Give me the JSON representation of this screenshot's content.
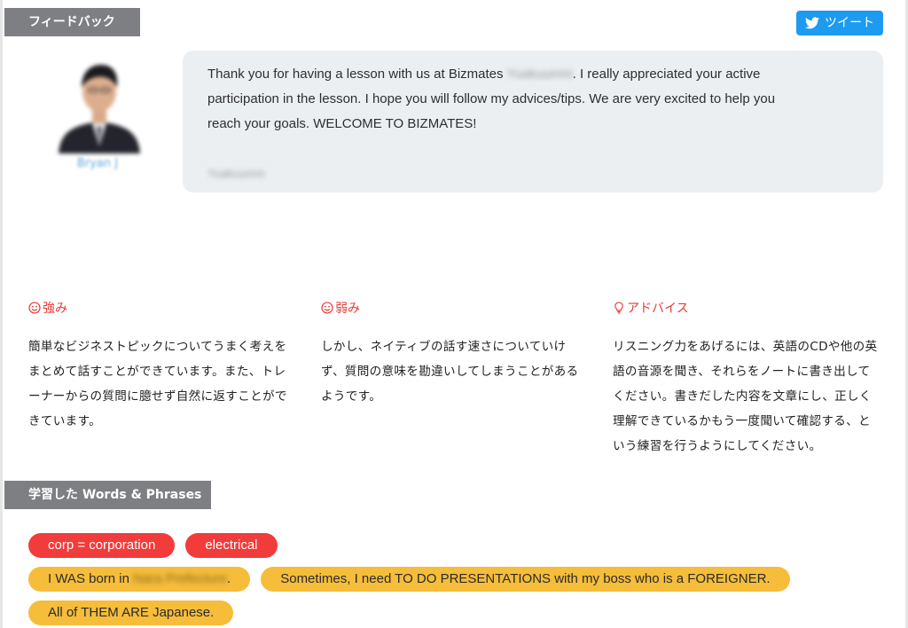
{
  "sections": {
    "feedback_title": "フィードバック",
    "words_title": "学習した Words & Phrases"
  },
  "tweet": {
    "label": "ツイート"
  },
  "trainer": {
    "name": "Bryan J"
  },
  "message": {
    "part1": "Thank you for having a lesson with us at Bizmates ",
    "name_blurred": "Yuakuumni",
    "part2": ". I really appreciated your active participation in the lesson. I hope you will follow my advices/tips. We are very excited to help you reach your goals. WELCOME TO BIZMATES!",
    "signature_blurred": "Yuakuumni"
  },
  "strength": {
    "title": "強み",
    "text": "簡単なビジネストピックについてうまく考えをまとめて話すことができています。また、トレーナーからの質問に臆せず自然に返すことができています。"
  },
  "weakness": {
    "title": "弱み",
    "text": "しかし、ネイティブの話す速さについていけず、質問の意味を勘違いしてしまうことがあるようです。"
  },
  "advice": {
    "title": "アドバイス",
    "text": "リスニング力をあげるには、英語のCDや他の英語の音源を聞き、それらをノートに書き出してください。書きだした内容を文章にし、正しく理解できているかもう一度聞いて確認する、という練習を行うようにしてください。"
  },
  "words": {
    "word1": "corp = corporation",
    "word2": "electrical",
    "phrase1_start": "I WAS born in ",
    "phrase1_blurred": "Nara Prefecture",
    "phrase1_end": ".",
    "phrase2": "Sometimes, I need TO DO PRESENTATIONS with my boss who is a FOREIGNER.",
    "phrase3": "All of THEM ARE Japanese."
  },
  "colors": {
    "section_tag": "#7d7f82",
    "tweet_button": "#1d9bf0",
    "accent_red": "#e53935",
    "chip_red": "#f23b3b",
    "chip_yellow": "#f5bd3a",
    "bubble": "#eceff2"
  },
  "icons": {
    "tweet": "twitter-bird-icon",
    "strength": "smile-icon",
    "weakness": "smile-icon",
    "advice": "lightbulb-icon"
  }
}
